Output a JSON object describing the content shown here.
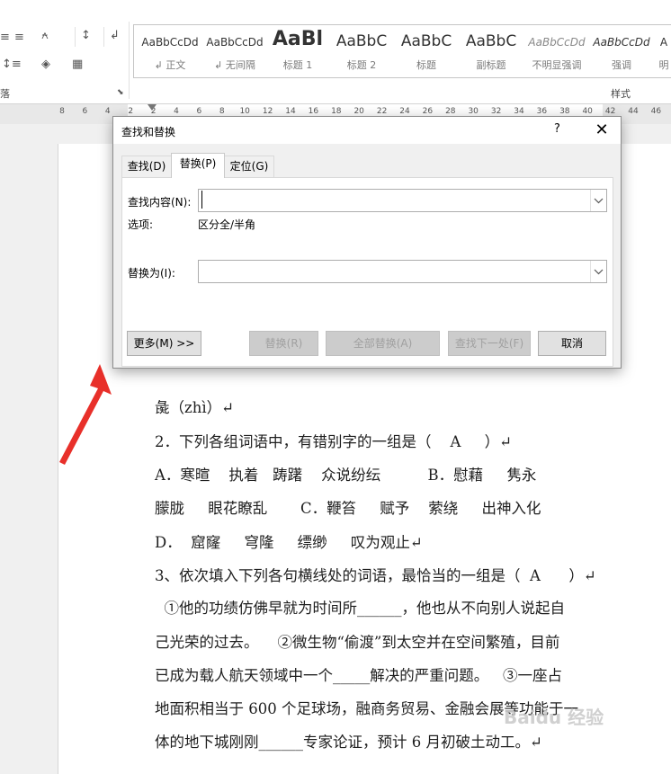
{
  "ribbon": {
    "paragraph_group_label": "落",
    "styles_group_label": "样式",
    "styles": [
      {
        "sample": "AaBbCcDd",
        "caption": "↲ 正文"
      },
      {
        "sample": "AaBbCcDd",
        "caption": "↲ 无间隔"
      },
      {
        "sample": "AaBl",
        "caption": "标题 1"
      },
      {
        "sample": "AaBbC",
        "caption": "标题 2"
      },
      {
        "sample": "AaBbC",
        "caption": "标题"
      },
      {
        "sample": "AaBbC",
        "caption": "副标题"
      },
      {
        "sample": "AaBbCcDd",
        "caption": "不明显强调"
      },
      {
        "sample": "AaBbCcDd",
        "caption": "强调"
      },
      {
        "sample": "A",
        "caption": "明"
      }
    ]
  },
  "ruler": {
    "ticks": [
      "8",
      "6",
      "4",
      "2",
      "2",
      "4",
      "6",
      "8",
      "10",
      "12",
      "14",
      "16",
      "18",
      "20",
      "22",
      "24",
      "26",
      "28",
      "30",
      "32",
      "34",
      "36",
      "38",
      "40",
      "42",
      "44",
      "46"
    ]
  },
  "dialog": {
    "title": "查找和替换",
    "help": "?",
    "close": "✕",
    "tabs": [
      "查找(D)",
      "替换(P)",
      "定位(G)"
    ],
    "active_tab": "替换(P)",
    "find_label": "查找内容(N):",
    "find_value": "",
    "options_label": "选项:",
    "options_value": "区分全/半角",
    "replace_label": "替换为(I):",
    "replace_value": "",
    "buttons": {
      "more": "更多(M) >>",
      "replace": "替换(R)",
      "replace_all": "全部替换(A)",
      "find_next": "查找下一处(F)",
      "cancel": "取消"
    }
  },
  "document": {
    "lines": [
      "彘（zhì）↵",
      "2．下列各组词语中，有错别字的一组是（    A     ）↵",
      "A．寒暄    执着   踌躇    众说纷纭          B．慰藉     隽永",
      "朦胧     眼花瞭乱       C．鞭笞     赋予    萦绕     出神入化",
      "D．  窟窿     穹隆     缥缈     叹为观止↵",
      "3、依次填入下列各句横线处的词语，最恰当的一组是（  A      ）↵",
      "  ①他的功绩仿佛早就为时间所______，他也从不向别人说起自",
      "己光荣的过去。    ②微生物“偷渡”到太空并在空间繁殖，目前",
      "已成为载人航天领域中一个_____解决的严重问题。   ③一座占",
      "地面积相当于 600 个足球场，融商务贸易、金融会展等功能于一",
      "体的地下城刚刚______专家论证，预计 6 月初破土动工。↵"
    ]
  },
  "watermark": "Baidu 经验"
}
